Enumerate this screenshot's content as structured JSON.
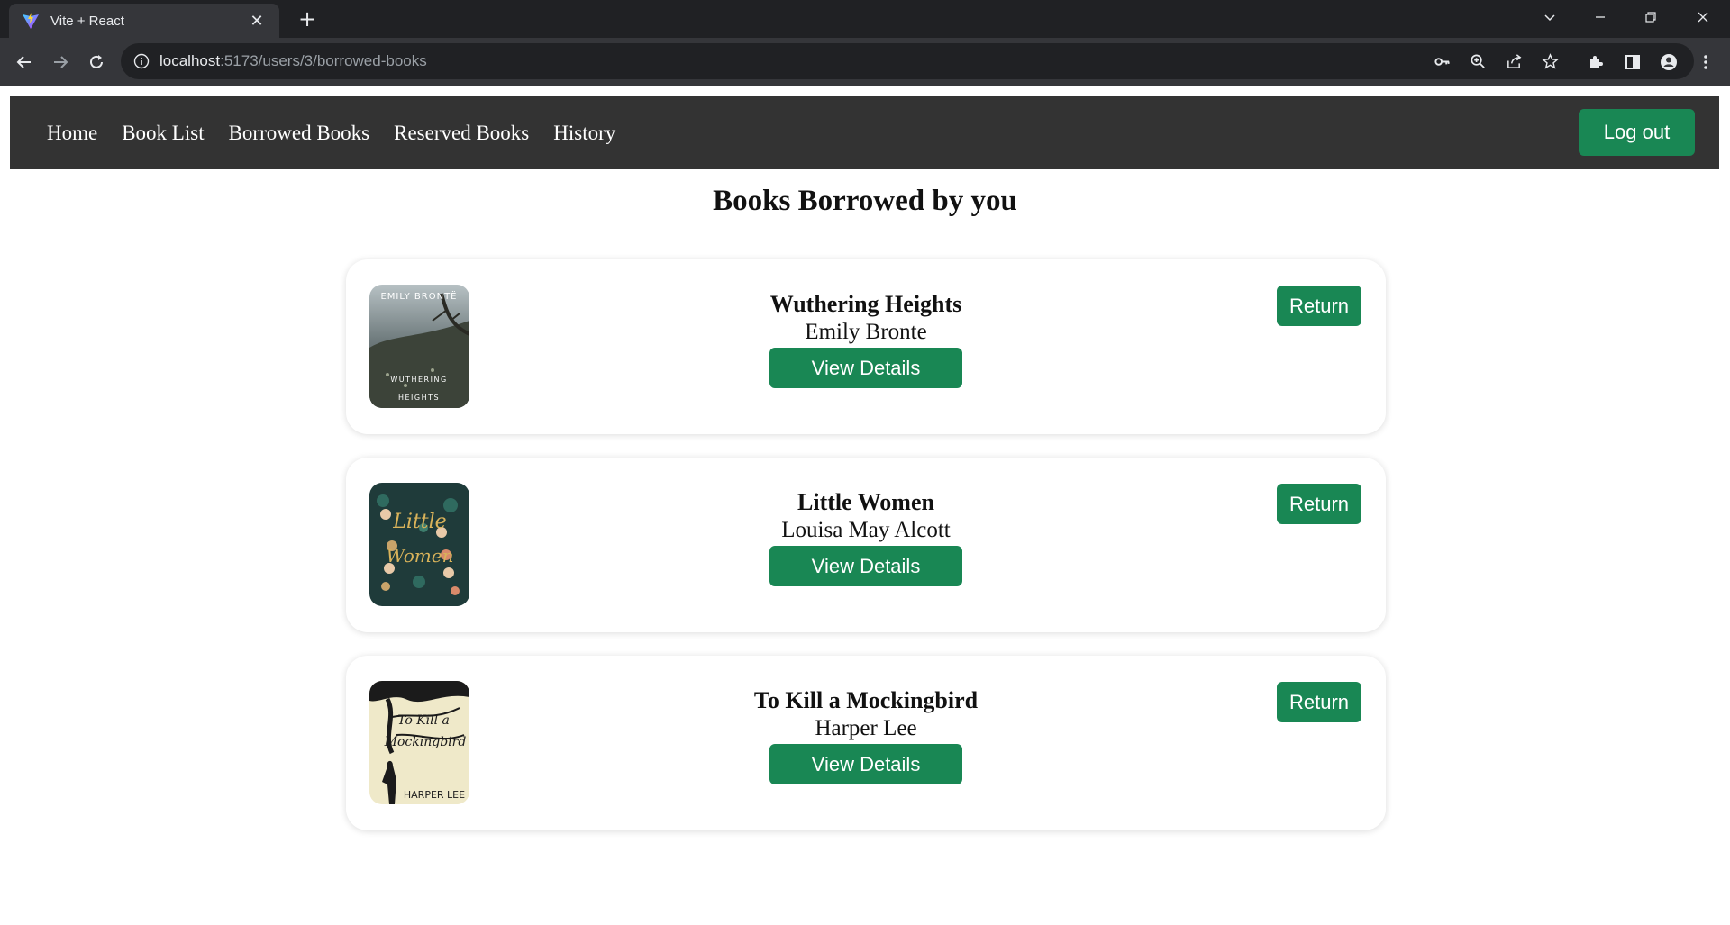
{
  "browser": {
    "tab_title": "Vite + React",
    "url_host": "localhost",
    "url_path": ":5173/users/3/borrowed-books"
  },
  "navbar": {
    "links": [
      "Home",
      "Book List",
      "Borrowed Books",
      "Reserved Books",
      "History"
    ],
    "logout_label": "Log out"
  },
  "page": {
    "heading": "Books Borrowed by you"
  },
  "books": [
    {
      "title": "Wuthering Heights",
      "author": "Emily Bronte",
      "cover_top_text": "EMILY BRONTË",
      "cover_bottom_text": "WUTHERING HEIGHTS",
      "details_label": "View Details",
      "return_label": "Return"
    },
    {
      "title": "Little Women",
      "author": "Louisa May Alcott",
      "cover_top_text": "Little Women",
      "cover_bottom_text": "",
      "details_label": "View Details",
      "return_label": "Return"
    },
    {
      "title": "To Kill a Mockingbird",
      "author": "Harper Lee",
      "cover_top_text": "To Kill a Mockingbird",
      "cover_bottom_text": "HARPER LEE",
      "details_label": "View Details",
      "return_label": "Return"
    }
  ],
  "colors": {
    "accent_green": "#198754",
    "navbar_bg": "#333333"
  }
}
